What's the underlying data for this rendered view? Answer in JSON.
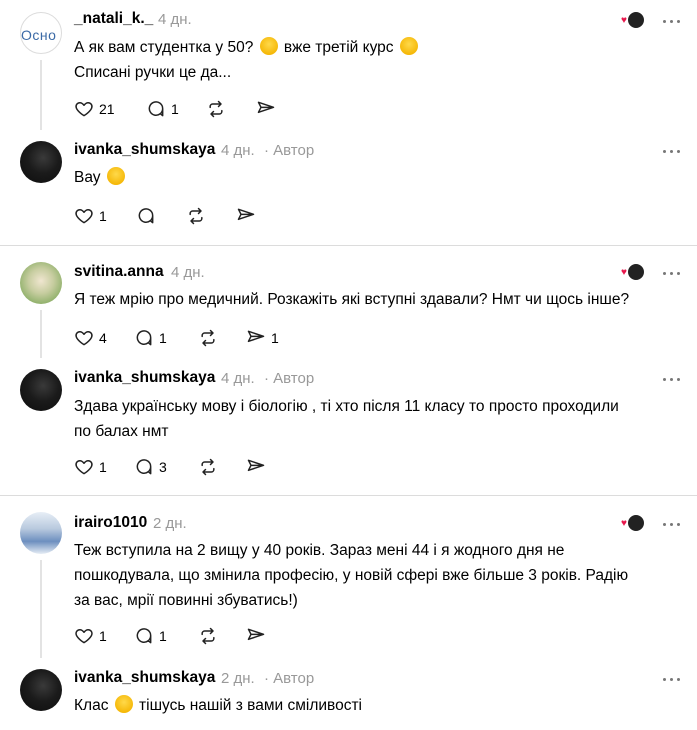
{
  "posts": [
    {
      "username": "_natali_k._",
      "time": "4 дн.",
      "author_tag": "",
      "avatar_text": "Осно",
      "lines": [
        "А як вам студентка у 50? 😁 вже третій курс 😊",
        "Списані ручки це да..."
      ],
      "likes": "21",
      "replies": "1",
      "shares": ""
    },
    {
      "username": "ivanka_shumskaya",
      "time": "4 дн.",
      "author_tag": "· Автор",
      "lines": [
        "Вау 🤩"
      ],
      "likes": "1",
      "replies": "",
      "shares": ""
    },
    {
      "username": "svitina.anna",
      "time": "4 дн.",
      "author_tag": "",
      "lines": [
        "Я теж мрію про медичний. Розкажіть які вступні здавали? Нмт чи щось інше?"
      ],
      "likes": "4",
      "replies": "1",
      "shares": "1"
    },
    {
      "username": "ivanka_shumskaya",
      "time": "4 дн.",
      "author_tag": "· Автор",
      "lines": [
        "Здава українську мову і біологію , ті хто після 11 класу то просто проходили",
        "по балах нмт"
      ],
      "likes": "1",
      "replies": "3",
      "shares": ""
    },
    {
      "username": "irairo1010",
      "time": "2 дн.",
      "author_tag": "",
      "lines": [
        "Теж вступила на 2 вищу у 40 років. Зараз мені 44 і я жодного дня не",
        "пошкодувала, що змінила професію, у новій сфері вже більше 3 років. Радію",
        "за вас, мрії повинні збуватись!)"
      ],
      "likes": "1",
      "replies": "1",
      "shares": ""
    },
    {
      "username": "ivanka_shumskaya",
      "time": "2 дн.",
      "author_tag": "· Автор",
      "lines": [
        "Клас 🙌 тішусь нашій з вами сміливості"
      ]
    }
  ],
  "icons": {
    "like": "heart-icon",
    "reply": "comment-icon",
    "repost": "repost-icon",
    "share": "share-icon",
    "more": "more-icon"
  },
  "colors": {
    "meta": "#999999",
    "separator": "#dcdcdc",
    "thread": "#e3e3e3",
    "badge_heart": "#e8174c"
  }
}
